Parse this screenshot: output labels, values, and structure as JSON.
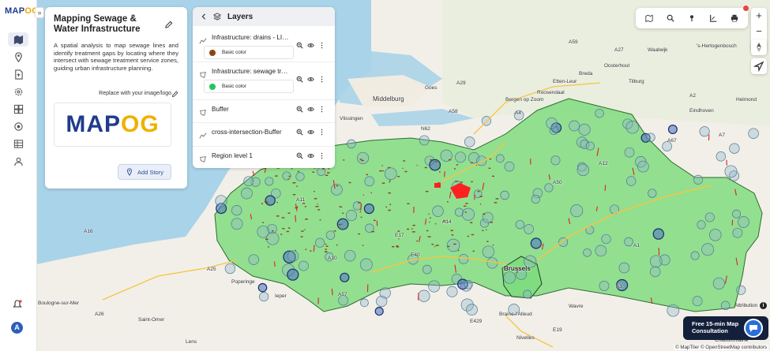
{
  "app": {
    "logo_text_1": "MAP",
    "logo_text_2": "OG",
    "rail_toggle": "»",
    "avatar_initial": "A"
  },
  "story": {
    "title": "Mapping Sewage & Water Infrastructure",
    "description": "A spatial analysis to map sewage lines and identify treatment gaps by locating where they intersect with sewage treatment service zones, guiding urban infrastructure planning.",
    "replace_label": "Replace with your image/logo",
    "add_story_label": "Add Story",
    "logo_big_1": "MAP",
    "logo_big_2": "OG"
  },
  "layers_panel": {
    "title": "Layers",
    "items": [
      {
        "name": "Infrastructure: drains - LINE",
        "legend": "Basic color",
        "legend_color": "#8b4513"
      },
      {
        "name": "Infrastructure: sewage treatment",
        "legend": "Basic color",
        "legend_color": "#22c55e"
      },
      {
        "name": "Buffer"
      },
      {
        "name": "cross-intersection-Buffer"
      },
      {
        "name": "Region level 1"
      }
    ]
  },
  "map": {
    "zoom_in": "+",
    "zoom_out": "−",
    "labels": {
      "city_brussels": "Brussels",
      "middelburg": "Middelburg",
      "tilburg": "Tilburg",
      "breda": "Breda",
      "eindhoven": "Eindhoven",
      "helmond": "Helmond",
      "shertogenbosch": "'s-Hertogenbosch",
      "waalwijk": "Waalwijk",
      "goes": "Goes",
      "zoom": "Bergen op Zoom",
      "etten": "Etten-Leur",
      "oosterhout": "Oosterhout",
      "roosendaal": "Roosendaal",
      "vlissingen": "Vlissingen",
      "poperinge": "Poperinge",
      "boulogne": "Boulogne-sur-Mer",
      "saint_omer": "Saint-Omer",
      "lens": "Lens",
      "braine": "Braine-l'Alleud",
      "nivelles": "Nivelles",
      "wavre": "Wavre",
      "ieper": "Ieper",
      "chaudfontaine": "Chaudfontaine",
      "a58": "A58",
      "a27": "A27",
      "a59": "A59",
      "a2": "A2",
      "a67": "A67",
      "n62": "N62",
      "a25": "A25",
      "e429": "E429",
      "e19": "E19",
      "a16": "A16",
      "a26": "A26",
      "a7": "A7",
      "a29": "A29",
      "a12": "A12",
      "a50": "A50",
      "e40": "E40",
      "e17": "E17",
      "a14": "A14",
      "a4": "A4",
      "a1": "A1",
      "a10": "A10",
      "a11": "A11",
      "a3": "A3",
      "a57": "A57"
    },
    "attribution_btn": "Attribution",
    "attribution": "© MapTiler © OpenStreetMap contributors"
  },
  "consult": {
    "text": "Free 15-min Map Consultation"
  },
  "colors": {
    "region_fill": "#7ddc7d",
    "region_stroke": "#3d7a3d",
    "buffer_circle": "#7fa9c4",
    "drains": "#8b4513",
    "hotspot": "#ff2020"
  }
}
